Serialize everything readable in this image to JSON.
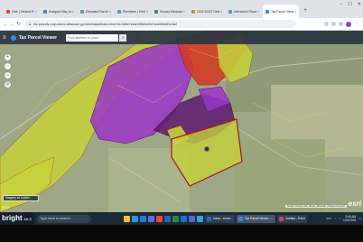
{
  "browser": {
    "tabs": [
      {
        "label": "Sale | Venture Re",
        "color": "#d94545",
        "active": false
      },
      {
        "label": "Hodgson Bay, and",
        "color": "#4f7fd0",
        "active": false
      },
      {
        "label": "Delaware Parcel V",
        "color": "#5d8fc9",
        "active": false
      },
      {
        "label": "Plenthese | Delaw",
        "color": "#5d8fc9",
        "active": false
      },
      {
        "label": "Sussex Delaware",
        "color": "#3b8c5a",
        "active": false
      },
      {
        "label": "2024 BOAT Delaw",
        "color": "#d08b2f",
        "active": false
      },
      {
        "label": "Interactive Parcel",
        "color": "#5d8fc9",
        "active": false
      },
      {
        "label": "Tax Parcel Viewer",
        "color": "#2f8fd8",
        "active": true
      }
    ],
    "new_tab": "+",
    "window_controls": [
      "–",
      "☐",
      "✕"
    ],
    "address": "fsc.parcels-map.dnrec.delaware.gov/esrimaps/index.html?id=3d5e7c4ab1f8a9c02d7a4e56b8f1c3a2",
    "icons": {
      "back": "arrow-left-icon",
      "forward": "arrow-right-icon",
      "reload": "reload-icon",
      "lock": "lock-icon"
    }
  },
  "app": {
    "title": "Tax Parcel Viewer",
    "search_placeholder": "Find address or place",
    "search_value": "",
    "menu_icon": "menu-icon",
    "search_icon": "search-icon"
  },
  "map": {
    "controls": [
      "+",
      "−",
      "⌂",
      "◎"
    ],
    "basemap_label": "Imagery w/ Labels",
    "scale_label": "600 ft",
    "attribution": "Sussex County GIS, Maxar, Microsoft | Powered by Esri",
    "esri_logo": "esri",
    "colors": {
      "yellow": "#c7d23a",
      "purple": "#8a2fb8",
      "red": "#d43a22",
      "dark_purple": "#5a1a6e",
      "outline": "#a01818"
    }
  },
  "taskbar": {
    "logo": "bright",
    "logo_sub": "MLS",
    "search_placeholder": "Type here to search",
    "pinned": [
      {
        "name": "file-explorer",
        "color": "#f3c03a"
      },
      {
        "name": "edge",
        "color": "#1f9bd8"
      },
      {
        "name": "mail",
        "color": "#2a78d6"
      },
      {
        "name": "store",
        "color": "#5c6ee0"
      },
      {
        "name": "chrome",
        "color": "#e04c3a"
      },
      {
        "name": "word",
        "color": "#2b5fb4"
      },
      {
        "name": "excel",
        "color": "#1f8a4c"
      },
      {
        "name": "outlook",
        "color": "#1a6fd0"
      },
      {
        "name": "teams",
        "color": "#6063c7"
      },
      {
        "name": "photos",
        "color": "#3aa0d8"
      }
    ],
    "windows": [
      {
        "label": "Inbox - Kevin...",
        "color": "#1a6fd0",
        "active": false
      },
      {
        "label": "Tax Parcel Viewer - ...",
        "color": "#2f8fd8",
        "active": true
      },
      {
        "label": "Untitled - Paint",
        "color": "#d94545",
        "active": false
      }
    ],
    "tray": {
      "temp": "41°F",
      "time": "9:46 AM",
      "date": "1/13/2023"
    }
  }
}
